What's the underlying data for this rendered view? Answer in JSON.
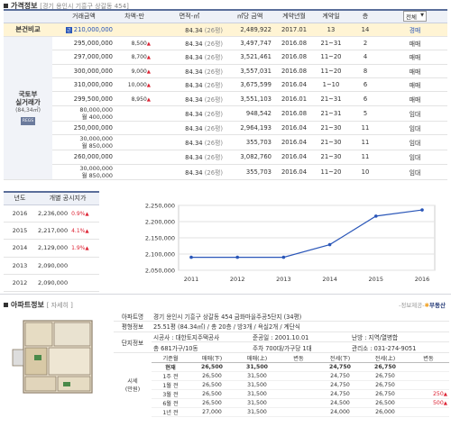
{
  "price_section": {
    "title": "가격정보",
    "subtitle": "[경기 용인시 기흥구 상갈동 454]",
    "headers": [
      "거래금액",
      "차액-만",
      "면적-㎡",
      "㎡당 금액",
      "계약년월",
      "계약일",
      "층"
    ],
    "filter": "전체",
    "main_row": {
      "label": "본건비교",
      "badge": "근",
      "amount": "210,000,000",
      "diff": "",
      "area": "84.34",
      "pyeong": "(26평)",
      "per_m2": "2,489,922",
      "ym": "2017.01",
      "day": "13",
      "floor": "14",
      "type": "경매"
    },
    "side_label_lines": [
      "국토부",
      "실거래가",
      "(84,34㎡)"
    ],
    "side_badge": "REGS",
    "rows": [
      {
        "amount": "295,000,000",
        "diff": "8,500",
        "area": "84.34",
        "pyeong": "(26평)",
        "per_m2": "3,497,747",
        "ym": "2016.08",
        "day": "21~31",
        "floor": "2",
        "type": "매매"
      },
      {
        "amount": "297,000,000",
        "diff": "8,700",
        "area": "84.34",
        "pyeong": "(26평)",
        "per_m2": "3,521,461",
        "ym": "2016.08",
        "day": "11~20",
        "floor": "4",
        "type": "매매"
      },
      {
        "amount": "300,000,000",
        "diff": "9,000",
        "area": "84.34",
        "pyeong": "(26평)",
        "per_m2": "3,557,031",
        "ym": "2016.08",
        "day": "11~20",
        "floor": "8",
        "type": "매매"
      },
      {
        "amount": "310,000,000",
        "diff": "10,000",
        "area": "84.34",
        "pyeong": "(26평)",
        "per_m2": "3,675,599",
        "ym": "2016.04",
        "day": "1~10",
        "floor": "6",
        "type": "매매"
      },
      {
        "amount": "299,500,000",
        "diff": "8,950",
        "area": "84.34",
        "pyeong": "(26평)",
        "per_m2": "3,551,103",
        "ym": "2016.01",
        "day": "21~31",
        "floor": "6",
        "type": "매매"
      },
      {
        "amount": "80,000,000",
        "amount2": "월 400,000",
        "diff": "",
        "area": "84.34",
        "pyeong": "(26평)",
        "per_m2": "948,542",
        "ym": "2016.08",
        "day": "21~31",
        "floor": "5",
        "type": "임대"
      },
      {
        "amount": "250,000,000",
        "diff": "",
        "area": "84.34",
        "pyeong": "(26평)",
        "per_m2": "2,964,193",
        "ym": "2016.04",
        "day": "21~30",
        "floor": "11",
        "type": "임대"
      },
      {
        "amount": "30,000,000",
        "amount2": "월 850,000",
        "diff": "",
        "area": "84.34",
        "pyeong": "(26평)",
        "per_m2": "355,703",
        "ym": "2016.04",
        "day": "21~30",
        "floor": "11",
        "type": "임대"
      },
      {
        "amount": "260,000,000",
        "diff": "",
        "area": "84.34",
        "pyeong": "(26평)",
        "per_m2": "3,082,760",
        "ym": "2016.04",
        "day": "21~30",
        "floor": "11",
        "type": "임대"
      },
      {
        "amount": "30,000,000",
        "amount2": "월 850,000",
        "diff": "",
        "area": "84.34",
        "pyeong": "(26평)",
        "per_m2": "355,703",
        "ym": "2016.04",
        "day": "11~20",
        "floor": "10",
        "type": "임대"
      }
    ]
  },
  "official_price": {
    "headers": [
      "년도",
      "개별 공시지가"
    ],
    "rows": [
      {
        "year": "2016",
        "price": "2,236,000",
        "change": "0.9%"
      },
      {
        "year": "2015",
        "price": "2,217,000",
        "change": "4.1%"
      },
      {
        "year": "2014",
        "price": "2,129,000",
        "change": "1.9%"
      },
      {
        "year": "2013",
        "price": "2,090,000",
        "change": ""
      },
      {
        "year": "2012",
        "price": "2,090,000",
        "change": ""
      }
    ]
  },
  "chart_data": {
    "type": "line",
    "x": [
      "2011",
      "2012",
      "2013",
      "2014",
      "2015",
      "2016"
    ],
    "values": [
      2090000,
      2090000,
      2090000,
      2129000,
      2217000,
      2236000
    ],
    "ylim": [
      2050000,
      2250000
    ],
    "yticks": [
      "2,250,000",
      "2,200,000",
      "2,150,000",
      "2,100,000",
      "2,050,000"
    ],
    "ytick_values": [
      2250000,
      2200000,
      2150000,
      2100000,
      2050000
    ],
    "grid": true,
    "line_color": "#2a56b8"
  },
  "apartment": {
    "title": "아파트정보",
    "detail_link": "[ 자세히 ]",
    "credit_prefix": "-정보제공-",
    "credit_brand": "부동산",
    "rows": [
      {
        "label": "아파트명",
        "value": "경기 용인시 기흥구 상갈동 454 금화마을주공5단지 (34평)"
      },
      {
        "label": "평형정보",
        "value": "25.51평 (84.34㎡) / 총 20층 / 방3개 / 욕실2개 / 계단식"
      }
    ],
    "complex_label": "단지정보",
    "complex_rows": [
      [
        "시공사 : 대한토지주택공사",
        "준공일 : 2001.10.01",
        "난방 : 지역/열병합"
      ],
      [
        "총 681가구/10동",
        "주차 700대/가구당 1대",
        "관리소 : 031-274-9051"
      ]
    ],
    "history_label": [
      "시세",
      "(만원)"
    ],
    "history_headers": [
      "기준월",
      "매매(下)",
      "매매(上)",
      "변동",
      "전세(下)",
      "전세(上)",
      "변동"
    ],
    "history_rows": [
      {
        "month": "현재",
        "s_lo": "26,500",
        "s_hi": "31,500",
        "s_chg": "",
        "j_lo": "24,750",
        "j_hi": "26,750",
        "j_chg": ""
      },
      {
        "month": "1주 전",
        "s_lo": "26,500",
        "s_hi": "31,500",
        "s_chg": "",
        "j_lo": "24,750",
        "j_hi": "26,750",
        "j_chg": ""
      },
      {
        "month": "1월 전",
        "s_lo": "26,500",
        "s_hi": "31,500",
        "s_chg": "",
        "j_lo": "24,750",
        "j_hi": "26,750",
        "j_chg": ""
      },
      {
        "month": "3월 전",
        "s_lo": "26,500",
        "s_hi": "31,500",
        "s_chg": "",
        "j_lo": "24,750",
        "j_hi": "26,750",
        "j_chg": "250"
      },
      {
        "month": "6월 전",
        "s_lo": "26,500",
        "s_hi": "31,500",
        "s_chg": "",
        "j_lo": "24,500",
        "j_hi": "26,500",
        "j_chg": "500"
      },
      {
        "month": "1년 전",
        "s_lo": "27,000",
        "s_hi": "31,500",
        "s_chg": "",
        "j_lo": "24,000",
        "j_hi": "26,000",
        "j_chg": ""
      }
    ]
  },
  "colors": {
    "accent": "#2a56b8",
    "header_bg": "#eef1f7",
    "header_border": "#5a6e9a",
    "highlight_row": "#fff4d4",
    "up_arrow": "#dd2233"
  }
}
